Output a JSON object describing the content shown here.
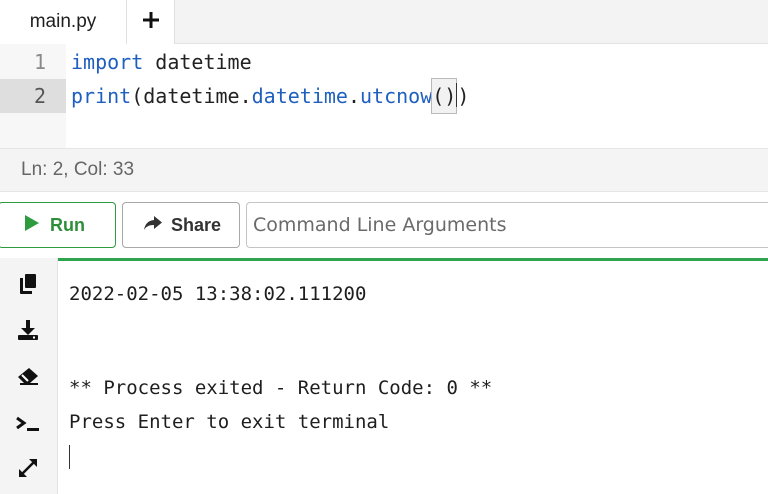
{
  "tabs": {
    "active_tab_label": "main.py",
    "add_tab_icon": "plus-icon"
  },
  "editor": {
    "lines": [
      {
        "number": "1",
        "tokens": {
          "kw": "import",
          "rest": " datetime"
        }
      },
      {
        "number": "2",
        "tokens": {
          "fn": "print",
          "open": "(",
          "obj": "datetime.",
          "attr1": "datetime",
          "dot": ".",
          "attr2": "utcnow",
          "call": "()",
          "close": ")"
        }
      }
    ]
  },
  "status": {
    "text": "Ln: 2,  Col: 33"
  },
  "toolbar": {
    "run_label": "Run",
    "share_label": "Share",
    "args_placeholder": "Command Line Arguments",
    "args_value": ""
  },
  "terminal": {
    "side_icons": [
      "copy-icon",
      "download-icon",
      "eraser-icon",
      "terminal-prompt-icon",
      "expand-icon"
    ],
    "output_lines": [
      "2022-02-05 13:38:02.111200",
      "** Process exited - Return Code: 0 **",
      "Press Enter to exit terminal"
    ]
  },
  "colors": {
    "accent_green": "#2ea44f",
    "keyword_blue": "#1f5fbf"
  }
}
